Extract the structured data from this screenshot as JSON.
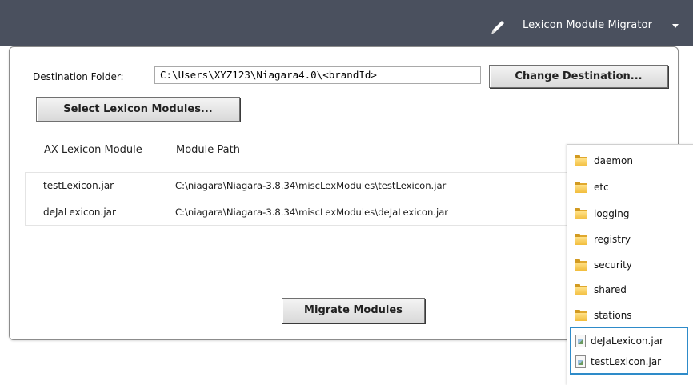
{
  "header": {
    "view_name": "Lexicon Module Migrator"
  },
  "destination": {
    "label": "Destination Folder:",
    "value": "C:\\Users\\XYZ123\\Niagara4.0\\<brandId>",
    "change_button": "Change Destination..."
  },
  "select_button": "Select Lexicon Modules...",
  "table": {
    "columns": [
      "AX Lexicon Module",
      "Module Path"
    ],
    "rows": [
      {
        "module": "testLexicon.jar",
        "path": "C:\\niagara\\Niagara-3.8.34\\miscLexModules\\testLexicon.jar"
      },
      {
        "module": "deJaLexicon.jar",
        "path": "C:\\niagara\\Niagara-3.8.34\\miscLexModules\\deJaLexicon.jar"
      }
    ]
  },
  "migrate_button": "Migrate Modules",
  "file_list": {
    "folders": [
      "daemon",
      "etc",
      "logging",
      "registry",
      "security",
      "shared",
      "stations"
    ],
    "files": [
      "deJaLexicon.jar",
      "testLexicon.jar"
    ]
  },
  "colors": {
    "header_bg": "#4a505e",
    "highlight_border": "#2e8bc9",
    "folder": "#f2bd3c"
  },
  "icons": {
    "edit": "pencil-icon",
    "dropdown": "chevron-down-icon",
    "folder": "folder-icon",
    "file": "jar-file-icon"
  }
}
